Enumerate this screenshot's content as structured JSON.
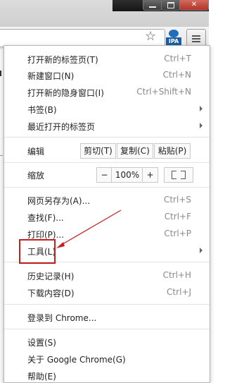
{
  "browser": {
    "accent_color": "#c61e1e",
    "toolbar": {
      "bookmark_star": "star-icon",
      "extension_badge": "IPA",
      "menu_button_icon": "hamburger-icon"
    }
  },
  "menu": {
    "items": [
      {
        "label": "打开新的标签页(T)",
        "shortcut": "Ctrl+T"
      },
      {
        "label": "新建窗口(N)",
        "shortcut": "Ctrl+N"
      },
      {
        "label": "打开新的隐身窗口(I)",
        "shortcut": "Ctrl+Shift+N"
      },
      {
        "label": "书签(B)",
        "submenu": true
      },
      {
        "label": "最近打开的标签页",
        "submenu": true
      }
    ],
    "edit": {
      "label": "编辑",
      "cut": "剪切(T)",
      "copy": "复制(C)",
      "paste": "粘贴(P)"
    },
    "zoom": {
      "label": "缩放",
      "minus": "−",
      "value": "100%",
      "plus": "+"
    },
    "page_items": [
      {
        "label": "网页另存为(A)...",
        "shortcut": "Ctrl+S"
      },
      {
        "label": "查找(F)...",
        "shortcut": "Ctrl+F"
      },
      {
        "label": "打印(P)...",
        "shortcut": "Ctrl+P"
      },
      {
        "label": "工具(L)",
        "submenu": true,
        "highlighted": true
      }
    ],
    "history_items": [
      {
        "label": "历史记录(H)",
        "shortcut": "Ctrl+H"
      },
      {
        "label": "下载内容(D)",
        "shortcut": "Ctrl+J"
      }
    ],
    "signin": {
      "label": "登录到 Chrome..."
    },
    "bottom_items": [
      {
        "label": "设置(S)"
      },
      {
        "label": "关于 Google Chrome(G)"
      },
      {
        "label": "帮助(E)"
      }
    ]
  }
}
